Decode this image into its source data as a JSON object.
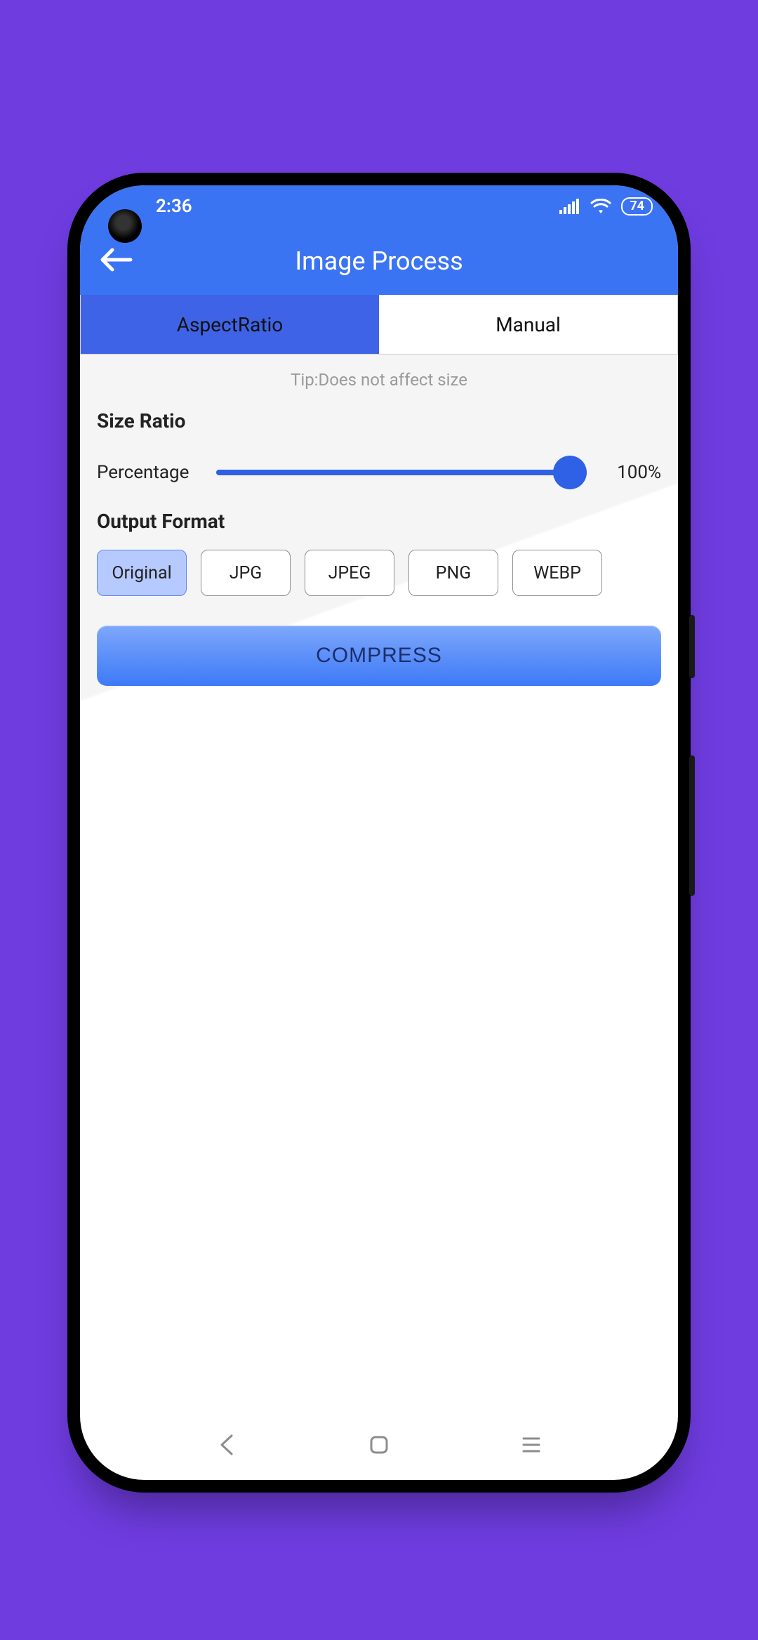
{
  "status": {
    "time": "2:36",
    "battery": "74"
  },
  "appbar": {
    "title": "Image Process"
  },
  "tabs": {
    "aspect_ratio": "AspectRatio",
    "manual": "Manual",
    "active": "aspect_ratio"
  },
  "tip": "Tip:Does not affect size",
  "size_ratio": {
    "title": "Size Ratio",
    "label": "Percentage",
    "value": 100,
    "display": "100%"
  },
  "output_format": {
    "title": "Output Format",
    "options": [
      "Original",
      "JPG",
      "JPEG",
      "PNG",
      "WEBP"
    ],
    "selected": "Original"
  },
  "compress_label": "COMPRESS",
  "icons": {
    "back": "back-arrow-icon",
    "signal": "signal-icon",
    "wifi": "wifi-icon",
    "nav_back": "nav-back-icon",
    "nav_home": "nav-home-icon",
    "nav_recent": "nav-recent-icon"
  },
  "colors": {
    "background": "#6f3ce0",
    "primary": "#3b74f2",
    "accent": "#2f61e6"
  }
}
